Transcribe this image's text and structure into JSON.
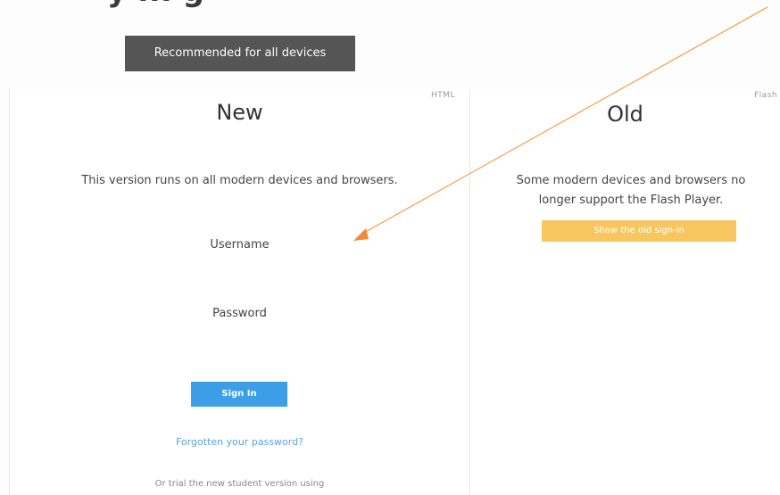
{
  "header": {
    "top_heading": "y ... g",
    "badge_text": "Recommended for all devices"
  },
  "new_panel": {
    "tech_label": "HTML",
    "title": "New",
    "description": "This version runs on all modern devices and browsers.",
    "username_label": "Username",
    "password_label": "Password",
    "signin_label": "Sign In",
    "forgot_link": "Forgotten your password?",
    "student_text": "Or trial the new student version using"
  },
  "old_panel": {
    "tech_label": "Flash",
    "title": "Old",
    "description": "Some modern devices and browsers no longer support the Flash Player.",
    "show_old_label": "Show the old sign-in"
  },
  "colors": {
    "badge_bg": "#555555",
    "signin_bg": "#3c9ee6",
    "old_button_bg": "#f7c65f",
    "arrow": "#f2a65a"
  }
}
